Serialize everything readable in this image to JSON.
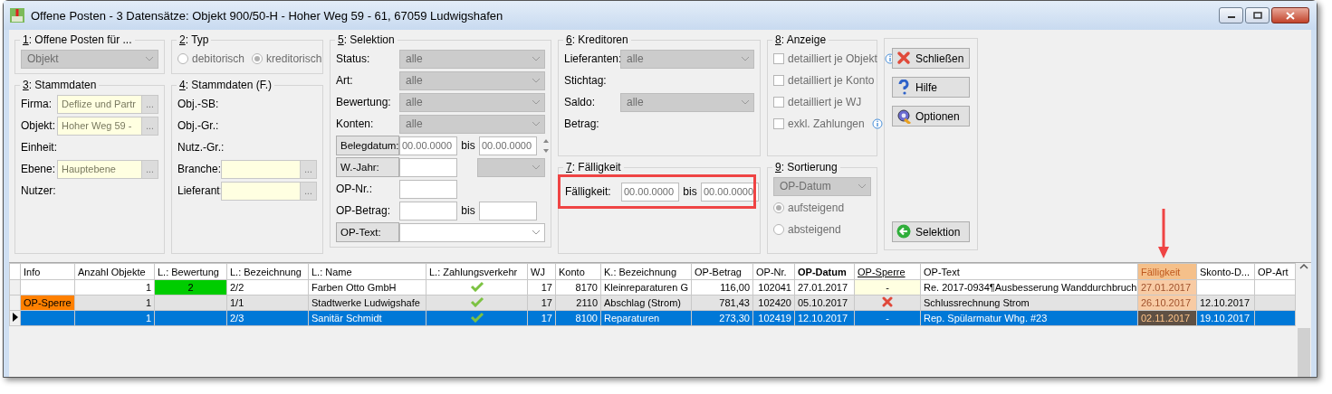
{
  "window": {
    "title": "Offene Posten - 3 Datensätze:  Objekt 900/50-H - Hoher Weg 59 - 61, 67059 Ludwigshafen"
  },
  "form_columns": [
    [
      {
        "title": "1: Offene Posten für ...",
        "rows": [
          {
            "controls": [
              {
                "kind": "combo",
                "value": "Objekt",
                "disabled": true
              }
            ]
          }
        ]
      },
      {
        "title": "3: Stammdaten",
        "rows": [
          {
            "label": "Firma:",
            "controls": [
              {
                "kind": "lookup",
                "value": "Deflize und Partr",
                "button": "..."
              }
            ]
          },
          {
            "label": "Objekt:",
            "controls": [
              {
                "kind": "lookup",
                "value": "Hoher Weg 59 -",
                "button": "..."
              }
            ]
          },
          {
            "label": "Einheit:",
            "controls": []
          },
          {
            "label": "Ebene:",
            "controls": [
              {
                "kind": "lookup",
                "value": "Hauptebene",
                "button": "..."
              }
            ]
          },
          {
            "label": "Nutzer:",
            "controls": []
          }
        ]
      }
    ],
    [
      {
        "title": "2: Typ",
        "rows": [
          {
            "controls": [
              {
                "kind": "radio",
                "text": "debitorisch",
                "selected": false,
                "disabled": true
              },
              {
                "kind": "radio",
                "text": "kreditorisch",
                "selected": true,
                "disabled": true
              }
            ]
          }
        ]
      },
      {
        "title": "4: Stammdaten (F.)",
        "rows": [
          {
            "label": "Obj.-SB:",
            "controls": []
          },
          {
            "label": "Obj.-Gr.:",
            "controls": []
          },
          {
            "label": "Nutz.-Gr.:",
            "controls": []
          },
          {
            "label": "Branche:",
            "controls": [
              {
                "kind": "lookup",
                "button": "..."
              }
            ]
          },
          {
            "label": "Lieferant:",
            "controls": [
              {
                "kind": "lookup",
                "button": "..."
              }
            ]
          }
        ]
      }
    ],
    [
      {
        "title": "5: Selektion",
        "rows": [
          {
            "label": "Status:",
            "kind": "plain",
            "controls": [
              {
                "kind": "combo",
                "value": "alle",
                "disabled": true
              }
            ]
          },
          {
            "label": "Art:",
            "kind": "plain",
            "controls": [
              {
                "kind": "combo",
                "value": "alle",
                "disabled": true
              }
            ]
          },
          {
            "label": "Bewertung:",
            "kind": "plain",
            "controls": [
              {
                "kind": "combo",
                "value": "alle",
                "disabled": true
              }
            ]
          },
          {
            "label": "Konten:",
            "kind": "plain",
            "controls": [
              {
                "kind": "combo",
                "value": "alle",
                "disabled": true
              }
            ]
          },
          {
            "label": "Belegdatum:",
            "kind": "button",
            "controls": [
              {
                "kind": "input",
                "value": "00.00.0000"
              },
              {
                "kind": "text",
                "text": "bis"
              },
              {
                "kind": "input",
                "value": "00.00.0000"
              },
              {
                "kind": "spinner"
              }
            ]
          },
          {
            "label": "W.-Jahr:",
            "kind": "button",
            "controls": [
              {
                "kind": "input"
              },
              {
                "kind": "combo",
                "disabled": true
              }
            ]
          },
          {
            "label": "OP-Nr.:",
            "kind": "plain",
            "controls": [
              {
                "kind": "input"
              }
            ]
          },
          {
            "label": "OP-Betrag:",
            "kind": "plain",
            "controls": [
              {
                "kind": "input"
              },
              {
                "kind": "text",
                "text": "bis"
              },
              {
                "kind": "input"
              }
            ]
          },
          {
            "label": "OP-Text:",
            "kind": "button",
            "controls": [
              {
                "kind": "combo",
                "disabled": false
              }
            ]
          }
        ]
      }
    ],
    [
      {
        "title": "6: Kreditoren",
        "rows": [
          {
            "label": "Lieferanten:",
            "controls": [
              {
                "kind": "combo",
                "value": "alle",
                "disabled": true
              }
            ]
          },
          {
            "label": "Stichtag:",
            "controls": []
          },
          {
            "label": "Saldo:",
            "controls": [
              {
                "kind": "combo",
                "value": "alle",
                "disabled": true
              }
            ]
          },
          {
            "label": "Betrag:",
            "controls": []
          }
        ]
      },
      {
        "title": "7: Fälligkeit",
        "rows": [
          {
            "label": "Fälligkeit:",
            "highlighted": true,
            "controls": [
              {
                "kind": "input",
                "value": "00.00.0000"
              },
              {
                "kind": "text",
                "text": "bis"
              },
              {
                "kind": "input",
                "value": "00.00.0000"
              }
            ]
          }
        ]
      }
    ],
    [
      {
        "title": "8: Anzeige",
        "rows": [
          {
            "controls": [
              {
                "kind": "checkbox",
                "text": "detailliert je Objekt",
                "checked": false,
                "disabled": true,
                "info": true
              }
            ]
          },
          {
            "controls": [
              {
                "kind": "checkbox",
                "text": "detailliert je Konto",
                "checked": false,
                "disabled": true,
                "info": false
              }
            ]
          },
          {
            "controls": [
              {
                "kind": "checkbox",
                "text": "detailliert je WJ",
                "checked": false,
                "disabled": true,
                "info": false
              }
            ]
          },
          {
            "controls": [
              {
                "kind": "checkbox",
                "text": "exkl. Zahlungen",
                "checked": false,
                "disabled": true,
                "info": true
              }
            ]
          }
        ]
      },
      {
        "title": "9: Sortierung",
        "rows": [
          {
            "controls": [
              {
                "kind": "combo",
                "value": "OP-Datum",
                "disabled": true
              }
            ]
          },
          {
            "controls": [
              {
                "kind": "radio",
                "text": "aufsteigend",
                "selected": true,
                "disabled": true
              }
            ]
          },
          {
            "controls": [
              {
                "kind": "radio",
                "text": "absteigend",
                "selected": false,
                "disabled": true
              }
            ]
          }
        ]
      }
    ]
  ],
  "buttons": [
    {
      "label": "Schließen",
      "kind": "close"
    },
    {
      "label": "Hilfe",
      "kind": "help"
    },
    {
      "label": "Optionen",
      "kind": "options"
    },
    {
      "label": "Selektion",
      "kind": "back"
    }
  ],
  "table": {
    "columns": [
      {
        "label": "Info"
      },
      {
        "label": "Anzahl Objekte"
      },
      {
        "label": "L.: Bewertung"
      },
      {
        "label": "L.: Bezeichnung"
      },
      {
        "label": "L.: Name"
      },
      {
        "label": "L.: Zahlungsverkehr"
      },
      {
        "label": "WJ"
      },
      {
        "label": "Konto"
      },
      {
        "label": "K.: Bezeichnung"
      },
      {
        "label": "OP-Betrag"
      },
      {
        "label": "OP-Nr."
      },
      {
        "label": "OP-Datum",
        "sorted": true
      },
      {
        "label": "OP-Sperre",
        "link": true
      },
      {
        "label": "OP-Text"
      },
      {
        "label": "Fälligkeit",
        "highlighted": true
      },
      {
        "label": "Skonto-D..."
      },
      {
        "label": "OP-Art"
      }
    ],
    "rows": [
      {
        "selected": false,
        "cells": [
          "",
          "1",
          {
            "text": "2",
            "color": "#00cc00"
          },
          "2/2",
          "Farben Otto GmbH",
          {
            "kind": "check"
          },
          "17",
          "8170",
          "Kleinreparaturen G",
          "116,00",
          "102041",
          "27.01.2017",
          {
            "text": "-",
            "color": "#ffffe1"
          },
          "Re. 2017-0934¶Ausbesserung Wanddurchbruch",
          "27.01.2017",
          "",
          ""
        ]
      },
      {
        "selected": false,
        "cells": [
          {
            "text": "OP-Sperre",
            "color": "#ff8000"
          },
          "1",
          "",
          "1/1",
          "Stadtwerke Ludwigshafe",
          {
            "kind": "check"
          },
          "17",
          "2110",
          "Abschlag (Strom)",
          "781,43",
          "102420",
          "05.10.2017",
          {
            "kind": "cross"
          },
          "Schlussrechnung Strom",
          "26.10.2017",
          "12.10.2017",
          ""
        ]
      },
      {
        "selected": true,
        "cells": [
          "",
          "1",
          "",
          "2/3",
          "Sanitär Schmidt",
          {
            "kind": "check"
          },
          "17",
          "8100",
          "Reparaturen",
          "273,30",
          "102419",
          "12.10.2017",
          "-",
          "Rep. Spülarmatur Whg. #23",
          "02.11.2017",
          "19.10.2017",
          ""
        ]
      }
    ]
  }
}
